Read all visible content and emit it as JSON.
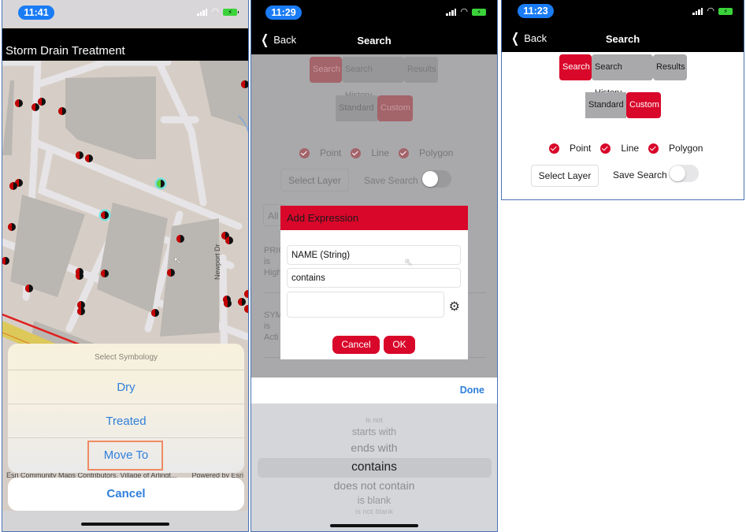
{
  "panels": [
    {
      "status": {
        "time": "11:41"
      },
      "app_title": "Storm Drain Treatment",
      "map": {
        "street_label": "Newport Dr",
        "attribution_left": "Esri Community Maps Contributors, Village of Arlingt...",
        "attribution_right": "Powered by Esri"
      },
      "action_sheet": {
        "title": "Select Symbology",
        "items": [
          {
            "label": "Dry"
          },
          {
            "label": "Treated"
          },
          {
            "label": "Move To",
            "highlighted": true
          }
        ],
        "cancel_label": "Cancel"
      }
    },
    {
      "status": {
        "time": "11:29"
      },
      "nav": {
        "back_label": "Back",
        "title": "Search"
      },
      "tabs": [
        {
          "label": "Search",
          "selected": true
        },
        {
          "label": "Search History",
          "selected": false
        },
        {
          "label": "Results",
          "selected": false
        }
      ],
      "mode": [
        {
          "label": "Standard",
          "selected": false
        },
        {
          "label": "Custom",
          "selected": true
        }
      ],
      "geometry_filters": [
        {
          "label": "Point",
          "checked": true
        },
        {
          "label": "Line",
          "checked": true
        },
        {
          "label": "Polygon",
          "checked": true
        }
      ],
      "select_layer_label": "Select Layer",
      "save_search_label": "Save Search",
      "save_search_on": false,
      "background": {
        "all_label": "All",
        "expr1": [
          "PRIC",
          "is",
          "High"
        ],
        "expr2": [
          "SYM",
          "is",
          "Acti"
        ]
      },
      "dialog": {
        "title": "Add Expression",
        "field_value": "NAME (String)",
        "operator_value": "contains",
        "value_input": "",
        "cancel_label": "Cancel",
        "ok_label": "OK"
      },
      "picker": {
        "done_label": "Done",
        "options": [
          "is not",
          "starts with",
          "ends with",
          "contains",
          "does not contain",
          "is blank",
          "is not blank"
        ],
        "selected": "contains"
      }
    },
    {
      "status": {
        "time": "11:23"
      },
      "nav": {
        "back_label": "Back",
        "title": "Search"
      },
      "tabs": [
        {
          "label": "Search",
          "selected": true
        },
        {
          "label": "Search History",
          "selected": false
        },
        {
          "label": "Results",
          "selected": false
        }
      ],
      "mode": [
        {
          "label": "Standard",
          "selected": false
        },
        {
          "label": "Custom",
          "selected": true
        }
      ],
      "geometry_filters": [
        {
          "label": "Point",
          "checked": true
        },
        {
          "label": "Line",
          "checked": true
        },
        {
          "label": "Polygon",
          "checked": true
        }
      ],
      "select_layer_label": "Select Layer",
      "save_search_label": "Save Search",
      "save_search_on": false
    }
  ],
  "colors": {
    "accent_red": "#d9072a",
    "ios_blue": "#2f7fdc",
    "segment_gray": "#a9a9ab"
  }
}
